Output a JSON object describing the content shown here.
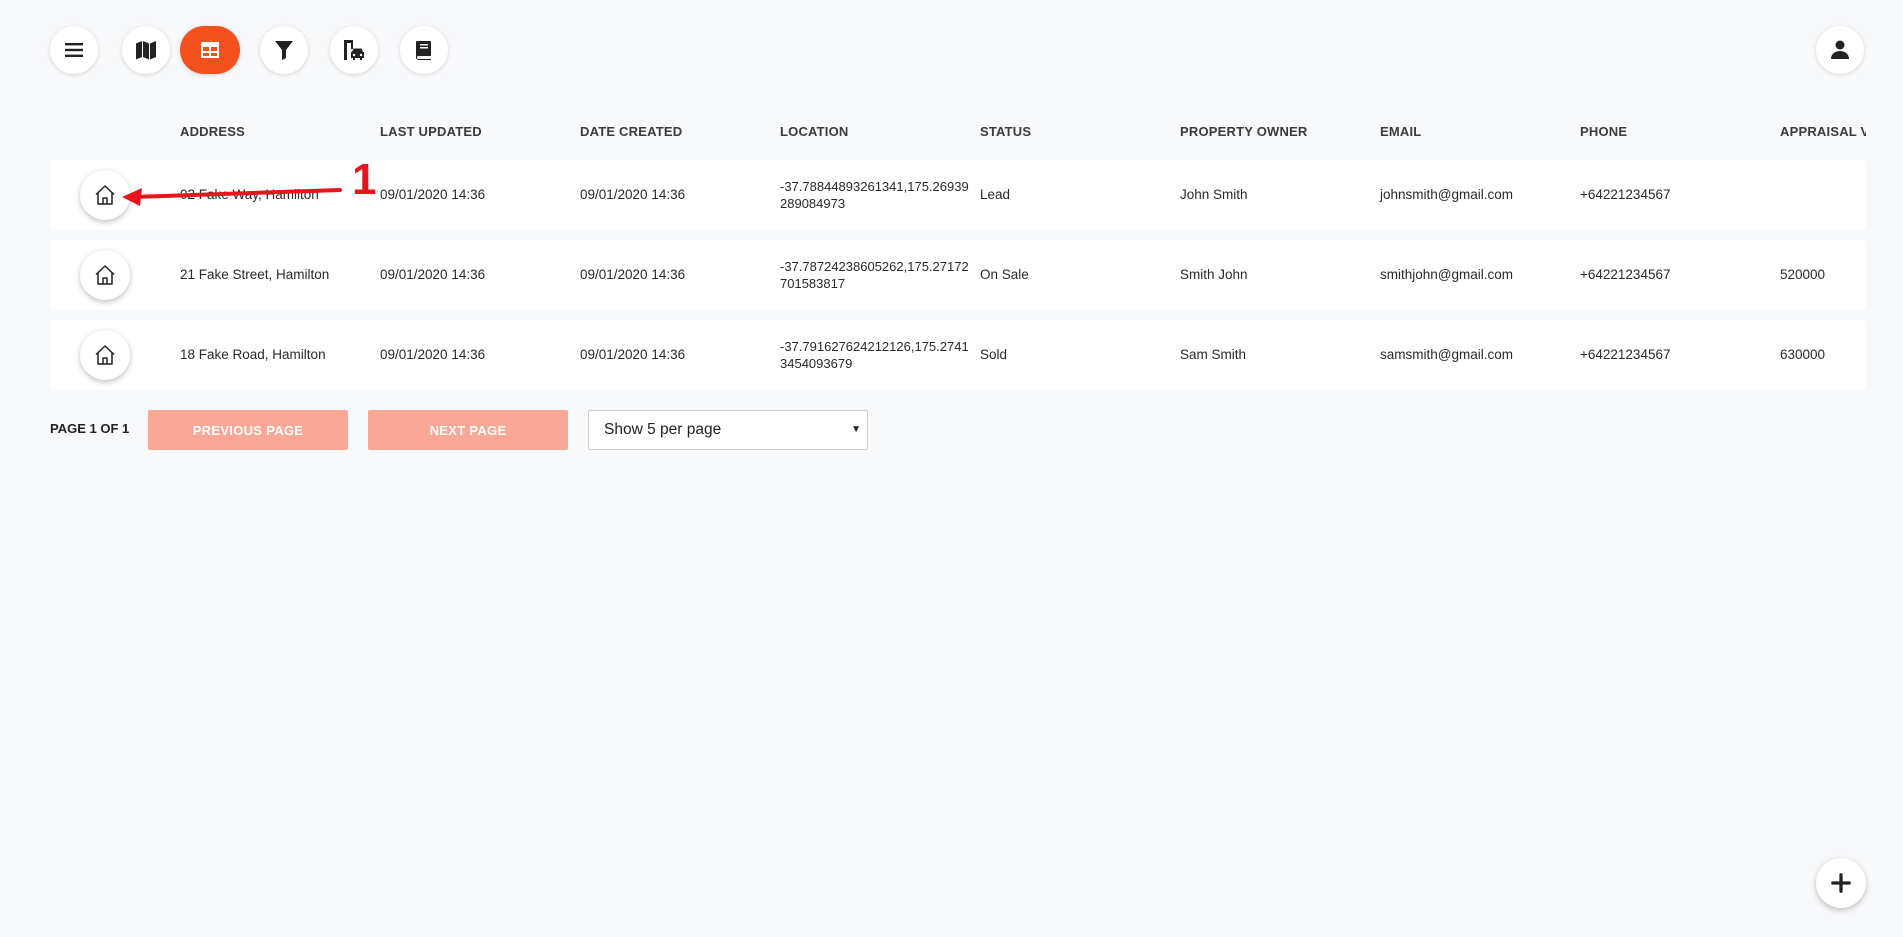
{
  "toolbar": {
    "items": [
      {
        "icon": "menu-icon"
      },
      {
        "icon": "map-icon"
      },
      {
        "icon": "table-icon",
        "active": true
      },
      {
        "icon": "filter-icon"
      },
      {
        "icon": "building-car-icon"
      },
      {
        "icon": "book-icon"
      }
    ],
    "account_icon": "account-icon",
    "accent_color": "#f4511e"
  },
  "table": {
    "columns": [
      "ADDRESS",
      "LAST UPDATED",
      "DATE CREATED",
      "LOCATION",
      "STATUS",
      "PROPERTY OWNER",
      "EMAIL",
      "PHONE",
      "APPRAISAL V"
    ],
    "rows": [
      {
        "address": "02 Fake Way, Hamilton",
        "last_updated": "09/01/2020 14:36",
        "date_created": "09/01/2020 14:36",
        "location": "-37.78844893261341,175.26939289084973",
        "status": "Lead",
        "owner": "John Smith",
        "email": "johnsmith@gmail.com",
        "phone": "+64221234567",
        "appraisal": ""
      },
      {
        "address": "21 Fake Street, Hamilton",
        "last_updated": "09/01/2020 14:36",
        "date_created": "09/01/2020 14:36",
        "location": "-37.78724238605262,175.27172701583817",
        "status": "On Sale",
        "owner": "Smith John",
        "email": "smithjohn@gmail.com",
        "phone": "+64221234567",
        "appraisal": "520000"
      },
      {
        "address": "18 Fake Road, Hamilton",
        "last_updated": "09/01/2020 14:36",
        "date_created": "09/01/2020 14:36",
        "location": "-37.791627624212126,175.27413454093679",
        "status": "Sold",
        "owner": "Sam Smith",
        "email": "samsmith@gmail.com",
        "phone": "+64221234567",
        "appraisal": "630000"
      }
    ]
  },
  "annotation": {
    "number": "1",
    "color": "#e8141c"
  },
  "pagination": {
    "label": "PAGE 1 OF 1",
    "previous_label": "PREVIOUS PAGE",
    "next_label": "NEXT PAGE",
    "per_page_selected": "Show 5 per page"
  },
  "fab": {
    "icon": "plus-icon"
  }
}
